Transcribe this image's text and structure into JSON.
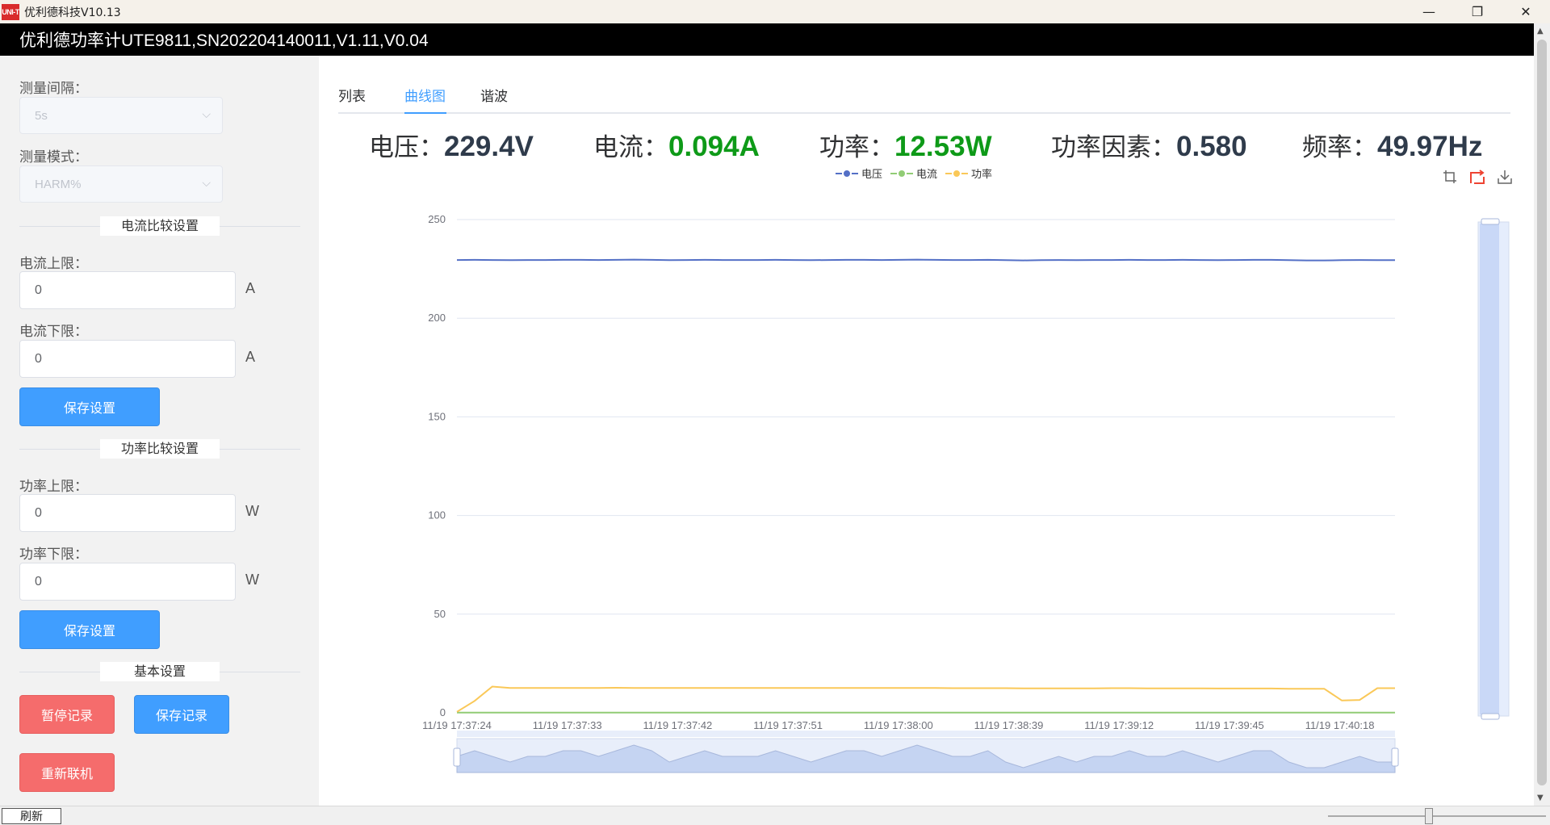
{
  "window": {
    "logo_text": "UNI-T",
    "title": "优利德科技V10.13",
    "minimize": "—",
    "maximize": "❐",
    "close": "✕"
  },
  "device_header": "优利德功率计UTE9811,SN202204140011,V1.11,V0.04",
  "sidebar": {
    "interval_label": "测量间隔：",
    "interval_value": "5s",
    "mode_label": "测量模式：",
    "mode_value": "HARM%",
    "current_section": "电流比较设置",
    "current_upper_label": "电流上限：",
    "current_upper_value": "0",
    "current_upper_unit": "A",
    "current_lower_label": "电流下限：",
    "current_lower_value": "0",
    "current_lower_unit": "A",
    "save_settings_1": "保存设置",
    "power_section": "功率比较设置",
    "power_upper_label": "功率上限：",
    "power_upper_value": "0",
    "power_upper_unit": "W",
    "power_lower_label": "功率下限：",
    "power_lower_value": "0",
    "power_lower_unit": "W",
    "save_settings_2": "保存设置",
    "basic_section": "基本设置",
    "pause_record": "暂停记录",
    "save_record": "保存记录",
    "reconnect": "重新联机"
  },
  "tabs": [
    {
      "label": "列表",
      "active": false
    },
    {
      "label": "曲线图",
      "active": true
    },
    {
      "label": "谐波",
      "active": false
    }
  ],
  "readings": {
    "voltage_label": "电压：",
    "voltage_value": "229.4V",
    "current_label": "电流：",
    "current_value": "0.094A",
    "power_label": "功率：",
    "power_value": "12.53W",
    "pf_label": "功率因素：",
    "pf_value": "0.580",
    "freq_label": "频率：",
    "freq_value": "49.97Hz"
  },
  "toolbox_icons": [
    "crop-icon",
    "restore-icon",
    "download-icon"
  ],
  "chart_data": {
    "type": "line",
    "ylim": [
      0,
      250
    ],
    "yticks": [
      0,
      50,
      100,
      150,
      200,
      250
    ],
    "xtick_labels": [
      "11/19 17:37:24",
      "11/19 17:37:33",
      "11/19 17:37:42",
      "11/19 17:37:51",
      "11/19 17:38:00",
      "11/19 17:38:39",
      "11/19 17:39:12",
      "11/19 17:39:45",
      "11/19 17:40:18"
    ],
    "legend_position": "top-center",
    "grid": true,
    "series": [
      {
        "name": "电压",
        "color": "#5470c6",
        "values": [
          229.5,
          229.6,
          229.5,
          229.4,
          229.5,
          229.5,
          229.6,
          229.6,
          229.5,
          229.6,
          229.7,
          229.6,
          229.4,
          229.5,
          229.6,
          229.5,
          229.5,
          229.5,
          229.6,
          229.5,
          229.4,
          229.5,
          229.6,
          229.6,
          229.5,
          229.6,
          229.7,
          229.6,
          229.5,
          229.5,
          229.6,
          229.4,
          229.3,
          229.4,
          229.5,
          229.4,
          229.5,
          229.5,
          229.6,
          229.5,
          229.5,
          229.6,
          229.5,
          229.4,
          229.5,
          229.6,
          229.6,
          229.4,
          229.3,
          229.3,
          229.4,
          229.5,
          229.4,
          229.4
        ]
      },
      {
        "name": "电流",
        "color": "#91cc75",
        "values": [
          0.094,
          0.094,
          0.094,
          0.094,
          0.094,
          0.094,
          0.094,
          0.094,
          0.094,
          0.094,
          0.094,
          0.094,
          0.094,
          0.094,
          0.094,
          0.094,
          0.094,
          0.094,
          0.094,
          0.094,
          0.094,
          0.094,
          0.094,
          0.094,
          0.094,
          0.094,
          0.094,
          0.094,
          0.094,
          0.094,
          0.094,
          0.094,
          0.094,
          0.094,
          0.094,
          0.094,
          0.094,
          0.094,
          0.094,
          0.094,
          0.094,
          0.094,
          0.094,
          0.094,
          0.094,
          0.094,
          0.094,
          0.094,
          0.094,
          0.094,
          0.094,
          0.094,
          0.094,
          0.094
        ]
      },
      {
        "name": "功率",
        "color": "#fac858",
        "values": [
          0.5,
          6.0,
          13.3,
          12.6,
          12.6,
          12.6,
          12.6,
          12.6,
          12.6,
          12.7,
          12.6,
          12.6,
          12.6,
          12.6,
          12.6,
          12.6,
          12.6,
          12.6,
          12.6,
          12.6,
          12.6,
          12.6,
          12.6,
          12.6,
          12.6,
          12.6,
          12.6,
          12.6,
          12.5,
          12.5,
          12.5,
          12.5,
          12.4,
          12.4,
          12.4,
          12.4,
          12.4,
          12.5,
          12.5,
          12.4,
          12.4,
          12.4,
          12.4,
          12.3,
          12.3,
          12.3,
          12.3,
          12.2,
          12.2,
          12.2,
          6.2,
          6.5,
          12.5,
          12.5
        ]
      }
    ]
  },
  "statusbar": {
    "refresh": "刷新"
  }
}
